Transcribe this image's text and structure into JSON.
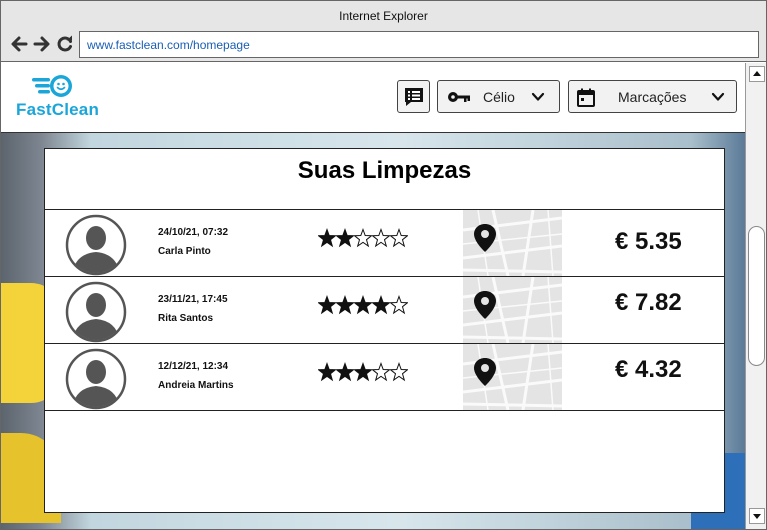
{
  "browser": {
    "title": "Internet Explorer",
    "url": "www.fastclean.com/homepage"
  },
  "header": {
    "logo_text": "FastClean",
    "user_label": "Célio",
    "appointments_label": "Marcações"
  },
  "main": {
    "title": "Suas Limpezas",
    "items": [
      {
        "datetime": "24/10/21, 07:32",
        "name": "Carla Pinto",
        "rating": 2,
        "price": "€ 5.35"
      },
      {
        "datetime": "23/11/21, 17:45",
        "name": "Rita Santos",
        "rating": 4,
        "price": "€ 7.82"
      },
      {
        "datetime": "12/12/21, 12:34",
        "name": "Andreia Martins",
        "rating": 3,
        "price": "€ 4.32"
      }
    ]
  },
  "colors": {
    "brand": "#1ba6d9",
    "url_text": "#1a5fb4"
  },
  "icons": [
    "back-arrow-icon",
    "forward-arrow-icon",
    "reload-icon",
    "list-icon",
    "key-icon",
    "chevron-down-icon",
    "calendar-icon",
    "map-pin-icon",
    "avatar-icon",
    "star-icon"
  ]
}
